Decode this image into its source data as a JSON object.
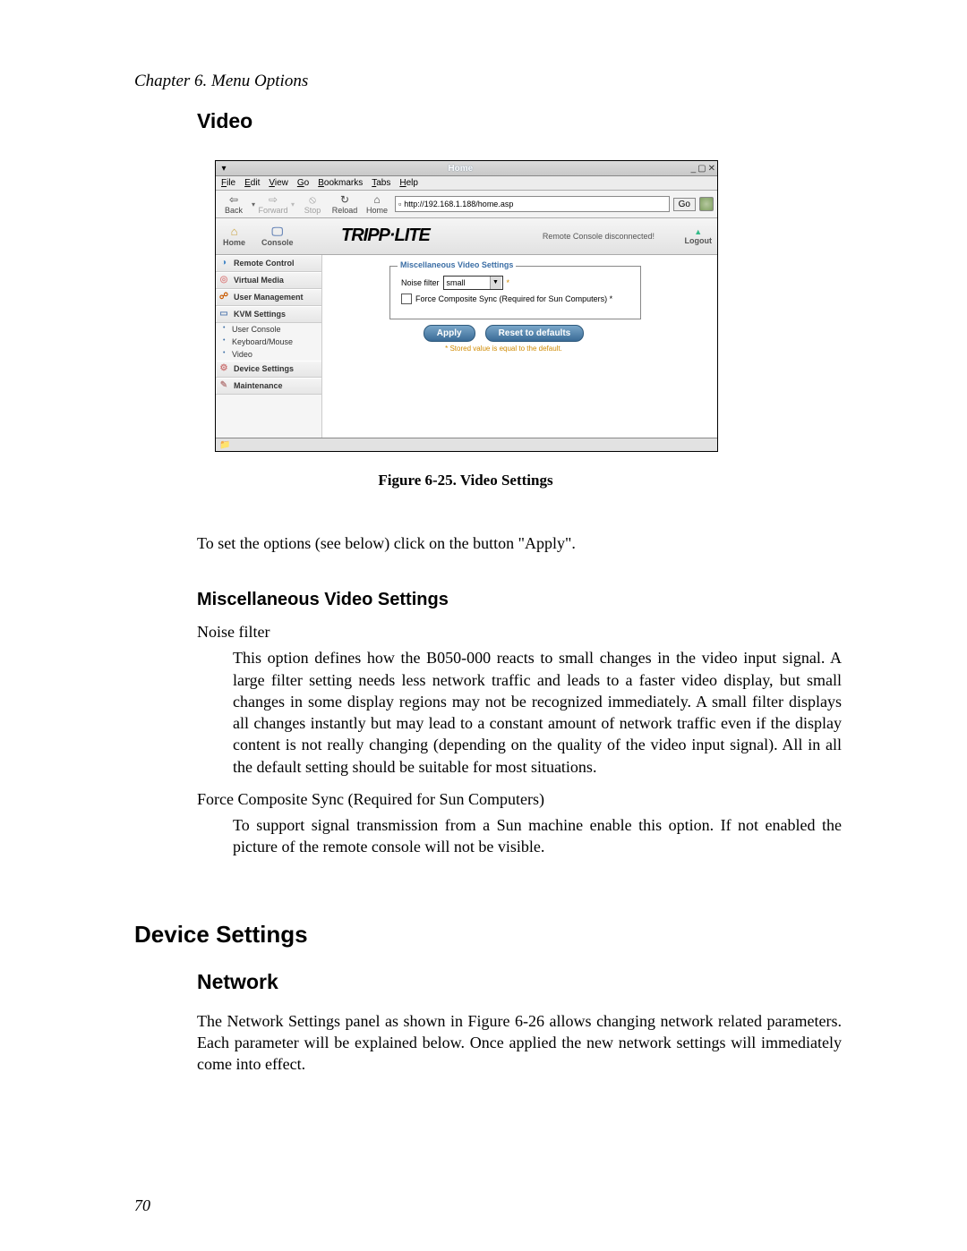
{
  "chapter_header": "Chapter 6. Menu Options",
  "section_video": "Video",
  "browser": {
    "title": "Home",
    "menu": {
      "file": "File",
      "edit": "Edit",
      "view": "View",
      "go": "Go",
      "bookmarks": "Bookmarks",
      "tabs": "Tabs",
      "help": "Help"
    },
    "toolbar": {
      "back": "Back",
      "forward": "Forward",
      "stop": "Stop",
      "reload": "Reload",
      "home": "Home",
      "go": "Go"
    },
    "url": "http://192.168.1.188/home.asp"
  },
  "header": {
    "home": "Home",
    "console": "Console",
    "brand": "TRIPP·LITE",
    "status": "Remote Console disconnected!",
    "logout": "Logout"
  },
  "sidebar": {
    "remote_control": "Remote Control",
    "virtual_media": "Virtual Media",
    "user_management": "User Management",
    "kvm_settings": "KVM Settings",
    "user_console": "User Console",
    "keyboard_mouse": "Keyboard/Mouse",
    "video": "Video",
    "device_settings": "Device Settings",
    "maintenance": "Maintenance"
  },
  "panel": {
    "legend": "Miscellaneous Video Settings",
    "noise_filter_label": "Noise filter",
    "noise_filter_value": "small",
    "force_sync": "Force Composite Sync (Required for Sun Computers) *",
    "apply": "Apply",
    "reset": "Reset to defaults",
    "footnote": "* Stored value is equal to the default."
  },
  "figure_caption": "Figure 6-25. Video Settings",
  "intro_para": "To set the options (see below) click on the button \"Apply\".",
  "misc_heading": "Miscellaneous Video Settings",
  "opt1_term": "Noise filter",
  "opt1_desc": "This option defines how the B050-000 reacts to small changes in the video input signal. A large filter setting needs less network traffic and leads to a faster video display, but small changes in some display regions may not be recognized immediately. A small filter displays all changes instantly but may lead to a constant amount of network traffic even if the display content is not really changing (depending on the quality of the video input signal). All in all the default setting should be suitable for most situations.",
  "opt2_term": "Force Composite Sync (Required for Sun Computers)",
  "opt2_desc": "To support signal transmission from a Sun machine enable this option. If not enabled the picture of the remote console will not be visible.",
  "device_settings_heading": "Device Settings",
  "network_heading": "Network",
  "network_para": "The Network Settings panel as shown in Figure 6-26 allows changing network related parameters. Each parameter will be explained below. Once applied the new network settings will immediately come into effect.",
  "page_number": "70"
}
